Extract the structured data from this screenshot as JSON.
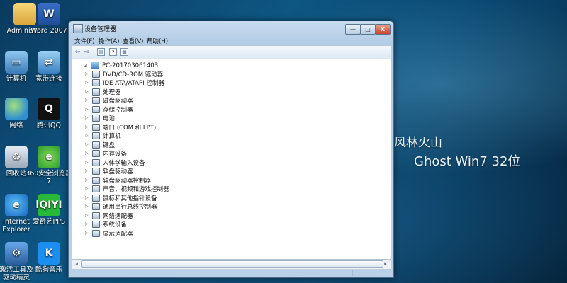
{
  "desktop": {
    "icons": [
      {
        "label": "Administ...",
        "icon": "folder-icon",
        "glyph": ""
      },
      {
        "label": "Word 2007",
        "icon": "word-icon",
        "glyph": "W"
      },
      {
        "label": "计算机",
        "icon": "computer-icon",
        "glyph": "▭"
      },
      {
        "label": "宽带连接",
        "icon": "network-icon",
        "glyph": "⇄"
      },
      {
        "label": "网络",
        "icon": "globe-network-icon",
        "glyph": ""
      },
      {
        "label": "腾讯QQ",
        "icon": "qq-icon",
        "glyph": "Q"
      },
      {
        "label": "回收站",
        "icon": "recycle-bin-icon",
        "glyph": "♻"
      },
      {
        "label": "360安全浏览器7",
        "icon": "360-browser-icon",
        "glyph": "e"
      },
      {
        "label": "Internet Explorer",
        "icon": "ie-icon",
        "glyph": "e"
      },
      {
        "label": "爱奇艺PPS",
        "icon": "iqiyi-icon",
        "glyph": "iQIYI"
      },
      {
        "label": "激活工具及驱动精灵",
        "icon": "tools-icon",
        "glyph": "⚙"
      },
      {
        "label": "酷狗音乐",
        "icon": "kugou-icon",
        "glyph": "K"
      }
    ]
  },
  "wallpaper": {
    "line1": "风林火山",
    "line2": "Ghost Win7 32位"
  },
  "window": {
    "title": "设备管理器",
    "buttons": {
      "minimize": "—",
      "maximize": "□",
      "close": "X"
    },
    "menu": [
      "文件(F)",
      "操作(A)",
      "查看(V)",
      "帮助(H)"
    ],
    "toolbar": {
      "back": "⇦",
      "forward": "⇨",
      "prop": "▤",
      "help": "?",
      "view": "▦"
    },
    "tree": {
      "root": "PC-20170306140З",
      "items": [
        "DVD/CD-ROM 驱动器",
        "IDE ATA/ATAPI 控制器",
        "处理器",
        "磁盘驱动器",
        "存储控制器",
        "电池",
        "端口 (COM 和 LPT)",
        "计算机",
        "键盘",
        "内存设备",
        "人体学输入设备",
        "软盘驱动器",
        "软盘驱动器控制器",
        "声音、视频和游戏控制器",
        "鼠标和其他指针设备",
        "通用串行总线控制器",
        "网络适配器",
        "系统设备",
        "显示适配器"
      ]
    },
    "scroll": {
      "left": "◂",
      "right": "▸"
    }
  }
}
